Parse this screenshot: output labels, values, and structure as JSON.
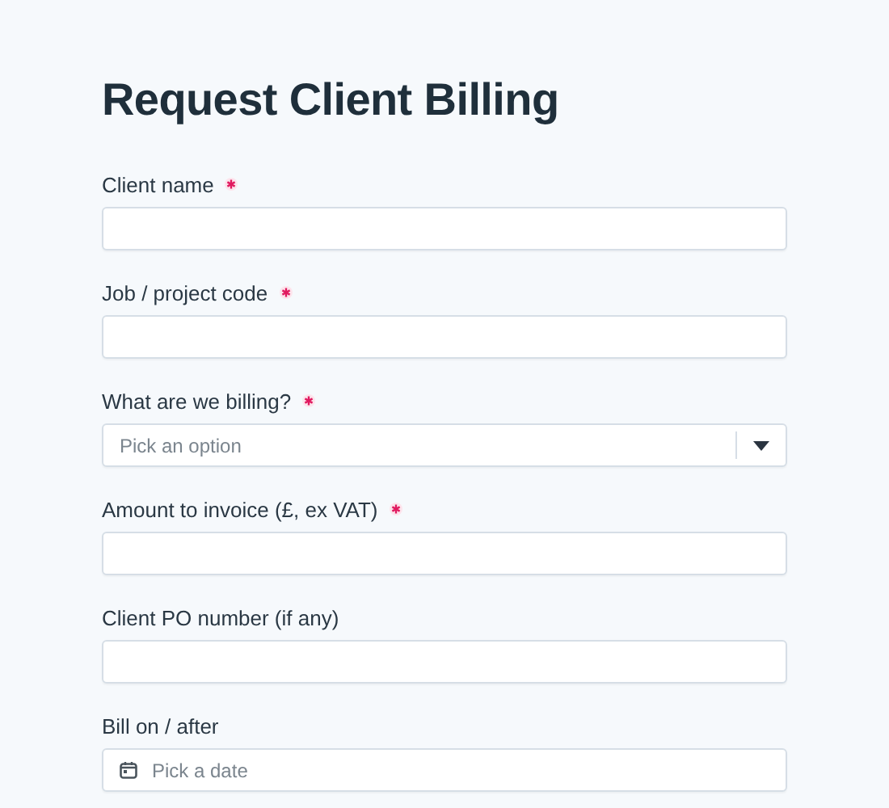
{
  "title": "Request Client Billing",
  "fields": [
    {
      "label": "Client name",
      "required": true,
      "kind": "text"
    },
    {
      "label": "Job / project code",
      "required": true,
      "kind": "text"
    },
    {
      "label": "What are we billing?",
      "required": true,
      "kind": "select",
      "placeholder": "Pick an option"
    },
    {
      "label": "Amount to invoice (£, ex VAT)",
      "required": true,
      "kind": "text"
    },
    {
      "label": "Client PO number (if any)",
      "required": false,
      "kind": "text"
    },
    {
      "label": "Bill on / after",
      "required": false,
      "kind": "date",
      "placeholder": "Pick a date"
    }
  ]
}
